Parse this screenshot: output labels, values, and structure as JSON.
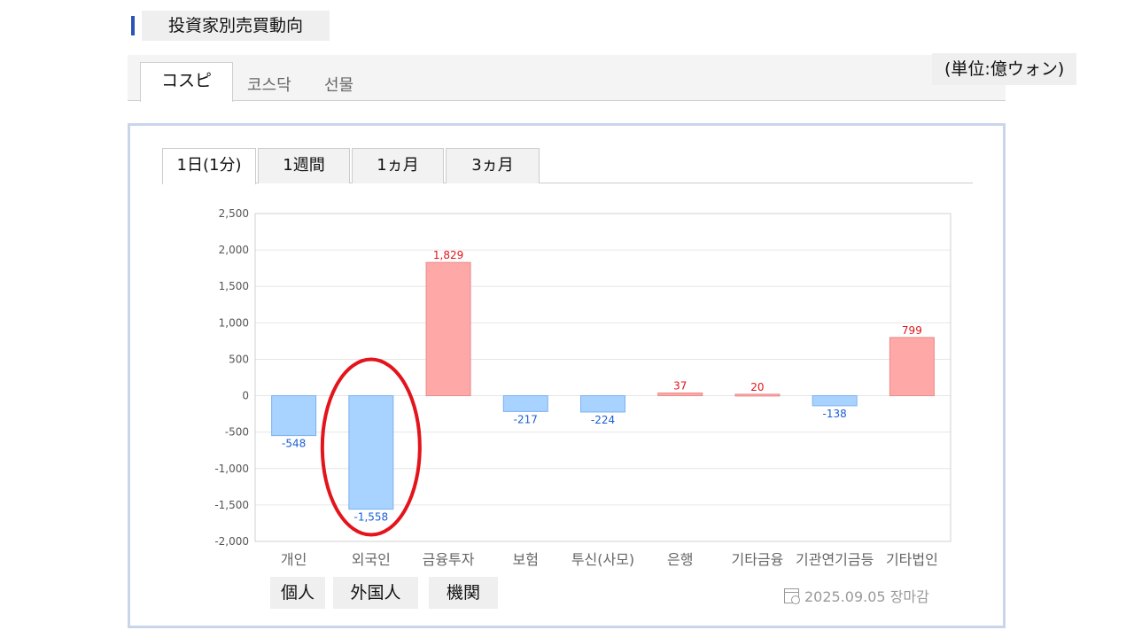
{
  "header": {
    "title": "投資家別売買動向"
  },
  "unit": "(単位:億ウォン)",
  "market_tabs": [
    "コスピ",
    "코스닥",
    "선물"
  ],
  "period_tabs": [
    "1日(1分)",
    "1週間",
    "1ヵ月",
    "3ヵ月"
  ],
  "jp_labels": [
    "個人",
    "外国人",
    "機関"
  ],
  "footer": {
    "date": "2025.09.05 장마감"
  },
  "colors": {
    "positive": "#ffa8a8",
    "positive_label": "#e0161b",
    "negative": "#a8d2ff",
    "negative_label": "#1a5fd6",
    "highlight": "#e3141b"
  },
  "chart_data": {
    "type": "bar",
    "categories": [
      "개인",
      "외국인",
      "금융투자",
      "보험",
      "투신(사모)",
      "은행",
      "기타금융",
      "기관연기금등",
      "기타법인"
    ],
    "values": [
      -548,
      -1558,
      1829,
      -217,
      -224,
      37,
      20,
      -138,
      799
    ],
    "data_labels": [
      "-548",
      "-1,558",
      "1,829",
      "-217",
      "-224",
      "37",
      "20",
      "-138",
      "799"
    ],
    "yticks": [
      "2,500",
      "2,000",
      "1,500",
      "1,000",
      "500",
      "0",
      "-500",
      "-1,000",
      "-1,500",
      "-2,000"
    ],
    "ylim": [
      -2000,
      2500
    ],
    "grid": true,
    "highlighted_category": "외국인"
  }
}
